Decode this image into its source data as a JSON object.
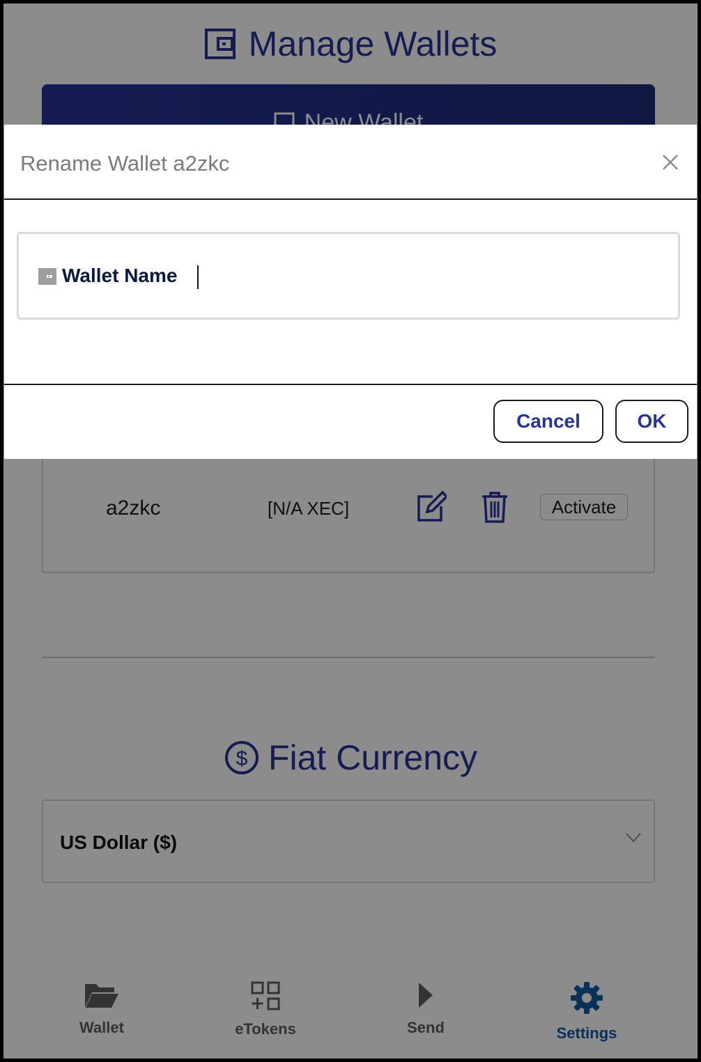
{
  "page": {
    "title": "Manage Wallets",
    "new_wallet_label": "New Wallet",
    "wallet": {
      "name": "a2zkc",
      "balance": "[N/A XEC]",
      "activate_label": "Activate"
    },
    "fiat": {
      "title": "Fiat Currency",
      "selected": "US Dollar ($)"
    }
  },
  "nav": {
    "items": [
      {
        "label": "Wallet",
        "icon": "folder-open-icon"
      },
      {
        "label": "eTokens",
        "icon": "grid-plus-icon"
      },
      {
        "label": "Send",
        "icon": "play-icon"
      },
      {
        "label": "Settings",
        "icon": "gear-icon",
        "active": true
      }
    ]
  },
  "modal": {
    "title": "Rename Wallet a2zkc",
    "input_placeholder": "Wallet Name",
    "cancel_label": "Cancel",
    "ok_label": "OK"
  },
  "colors": {
    "primary": "#273498",
    "active_nav": "#0d5aa0",
    "overlay": "rgba(0,0,0,0.45)"
  }
}
